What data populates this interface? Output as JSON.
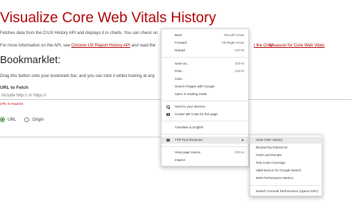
{
  "page": {
    "title": "Visualize Core Web Vitals History",
    "intro": "Fetches data from the CrUX History API and displays it in charts. You can check on",
    "more_info_prefix": "For more information on the API, see ",
    "more_info_link": "Chrome UX Report History API",
    "more_info_mid": " and read the",
    "right_link_1": "t the Only",
    "right_link_2": "Measure for Core Web Vitals",
    "section_title": "Bookmarklet:",
    "bookmarklet_desc": "Drag this button onto your bookmark bar, and you can click it whilst looking at any",
    "url_label": "URL to Fetch",
    "url_placeholder": "Include http:// or https://",
    "url_error": "URL is required",
    "radio_options": [
      "URL",
      "Origin"
    ]
  },
  "context_menu": {
    "items": [
      {
        "label": "Back",
        "shortcut": "Alt+Left Arrow"
      },
      {
        "label": "Forward",
        "shortcut": "Alt+Right Arrow"
      },
      {
        "label": "Reload",
        "shortcut": "Ctrl+R"
      },
      {
        "label": "Save as...",
        "shortcut": "Ctrl+S"
      },
      {
        "label": "Print...",
        "shortcut": "Ctrl+P"
      },
      {
        "label": "Cast..."
      },
      {
        "label": "Search images with Google"
      },
      {
        "label": "Open in reading mode"
      },
      {
        "label": "Send to your devices",
        "icon": "monitor-icon"
      },
      {
        "label": "Create QR Code for this page",
        "icon": "qr-code-icon"
      },
      {
        "label": "Translate to English"
      },
      {
        "label": "TTR Tool Shortcuts",
        "icon": "extension-icon",
        "submenu": true
      },
      {
        "label": "View page source",
        "shortcut": "Ctrl+U"
      },
      {
        "label": "Inspect"
      }
    ],
    "submenu_arrow": "▶"
  },
  "submenu": {
    "items": [
      "View CWV History",
      "Blocked by Robots.txt",
      "Fetch and Render",
      "Test Code Coverage",
      "Valid favicon for Google Search",
      "Web Performance Metrics",
      "Search Console Performance (opens GSC)"
    ]
  },
  "colors": {
    "title_red": "#b00000",
    "link_red": "#b00000",
    "error_red": "#c00000",
    "radio_green": "#2e7d32",
    "menu_highlight": "#e8e8e8"
  }
}
